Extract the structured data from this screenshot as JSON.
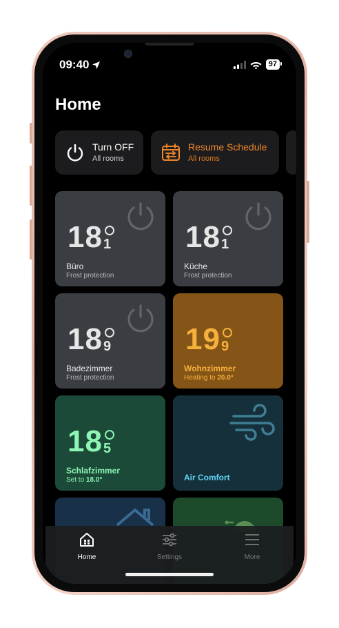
{
  "status": {
    "time": "09:40",
    "battery": "97"
  },
  "page": {
    "title": "Home"
  },
  "actions": [
    {
      "title": "Turn OFF",
      "subtitle": "All rooms",
      "color": "#ffffff",
      "icon": "power-icon"
    },
    {
      "title": "Resume Schedule",
      "subtitle": "All rooms",
      "color": "#f0882a",
      "icon": "schedule-icon"
    }
  ],
  "rooms": [
    {
      "int": "18",
      "dec": "1",
      "name": "Büro",
      "status": "Frost protection",
      "status_bold": "",
      "bg": "#3a3d42",
      "temp_color": "#e6e6e6",
      "icon": "power-icon"
    },
    {
      "int": "18",
      "dec": "1",
      "name": "Küche",
      "status": "Frost protection",
      "status_bold": "",
      "bg": "#3a3d42",
      "temp_color": "#e6e6e6",
      "icon": "power-icon"
    },
    {
      "int": "18",
      "dec": "9",
      "name": "Badezimmer",
      "status": "Frost protection",
      "status_bold": "",
      "bg": "#3a3d42",
      "temp_color": "#e6e6e6",
      "icon": "power-icon"
    },
    {
      "int": "19",
      "dec": "9",
      "name": "Wohnzimmer",
      "status": "Heating to ",
      "status_bold": "20.0°",
      "bg": "#855517",
      "temp_color": "#f5b03d",
      "icon": "heat-icon"
    },
    {
      "int": "18",
      "dec": "5",
      "name": "Schlafzimmer",
      "status": "Set to ",
      "status_bold": "18.0°",
      "bg": "#1b4a38",
      "temp_color": "#8ef5b5",
      "icon": "none"
    },
    {
      "name": "Air Comfort",
      "bg": "#16303b",
      "name_color": "#5fd3f2",
      "icon": "wind-icon"
    }
  ],
  "tabs": [
    {
      "label": "Home",
      "icon": "home-icon",
      "active": true
    },
    {
      "label": "Settings",
      "icon": "sliders-icon",
      "active": false
    },
    {
      "label": "More",
      "icon": "menu-icon",
      "active": false
    }
  ],
  "colors": {
    "accent_orange": "#f0882a",
    "green_text": "#8ef5b5",
    "air_text": "#5fd3f2",
    "tile_grey": "#3a3d42"
  }
}
